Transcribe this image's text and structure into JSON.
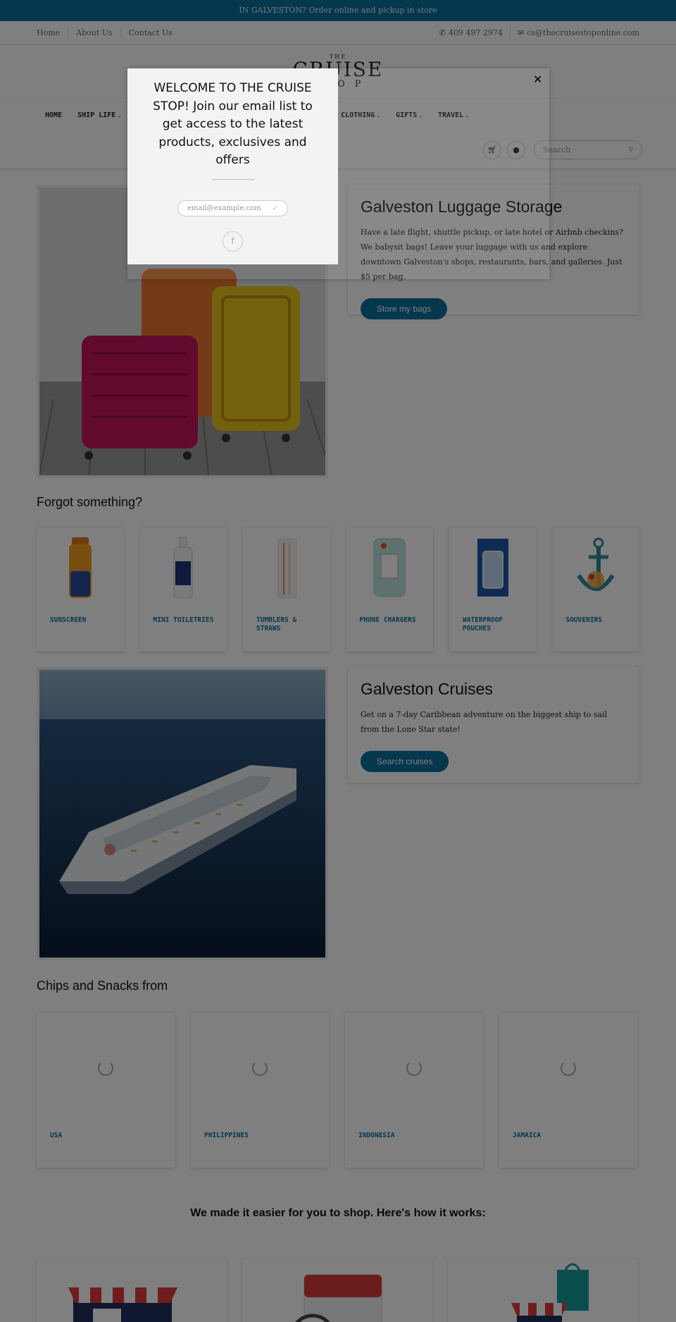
{
  "announcement": "IN GALVESTON? Order online and pickup in store",
  "topbar": {
    "links": [
      "Home",
      "About Us",
      "Contact Us"
    ],
    "phone": "409 497 2974",
    "email": "cs@thecruisestoponline.com"
  },
  "logo": {
    "line1": "THE",
    "line2": "CRUISE",
    "line3": "STOP"
  },
  "nav": {
    "left": [
      {
        "label": "HOME",
        "dropdown": false
      },
      {
        "label": "SHIP LIFE",
        "dropdown": true
      }
    ],
    "right": [
      {
        "label": "CLOTHING",
        "dropdown": true
      },
      {
        "label": "GIFTS",
        "dropdown": true
      },
      {
        "label": "TRAVEL",
        "dropdown": true
      }
    ]
  },
  "search": {
    "placeholder": "Search"
  },
  "luggage": {
    "title": "Galveston Luggage Storage",
    "text": "Have a late flight, shuttle pickup, or late hotel or Airbnb checkins? We babysit bags! Leave your luggage with us and explore downtown Galveston's shops, restaurants, bars, and galleries. Just $5 per bag.",
    "button": "Store my bags"
  },
  "forgot": {
    "title": "Forgot something?",
    "items": [
      {
        "label": "SUNSCREEN",
        "icon": "sunscreen-bottle-icon"
      },
      {
        "label": "MINI TOILETRIES",
        "icon": "spray-bottle-icon"
      },
      {
        "label": "TUMBLERS & STRAWS",
        "icon": "straw-pack-icon"
      },
      {
        "label": "PHONE CHARGERS",
        "icon": "charger-pack-icon"
      },
      {
        "label": "WATERPROOF POUCHES",
        "icon": "phone-pouch-icon"
      },
      {
        "label": "SOUVENIRS",
        "icon": "anchor-ornament-icon"
      }
    ]
  },
  "cruises": {
    "title": "Galveston Cruises",
    "text": "Get on a 7-day Caribbean adventure on the biggest ship to sail from the Lone Star state!",
    "button": "Search cruises"
  },
  "snacks": {
    "title": "Chips and Snacks from",
    "items": [
      "USA",
      "PHILIPPINES",
      "INDONESIA",
      "JAMAICA"
    ]
  },
  "how": {
    "title": "We made it easier for you to shop.  Here's how it works:"
  },
  "modal": {
    "title": "WELCOME TO THE CRUISE STOP! Join our email list to get access to the latest products, exclusives and offers",
    "email_placeholder": "email@example.com"
  },
  "colors": {
    "brand": "#0a6e9e",
    "overlay": "rgba(0,0,0,0.5)"
  }
}
